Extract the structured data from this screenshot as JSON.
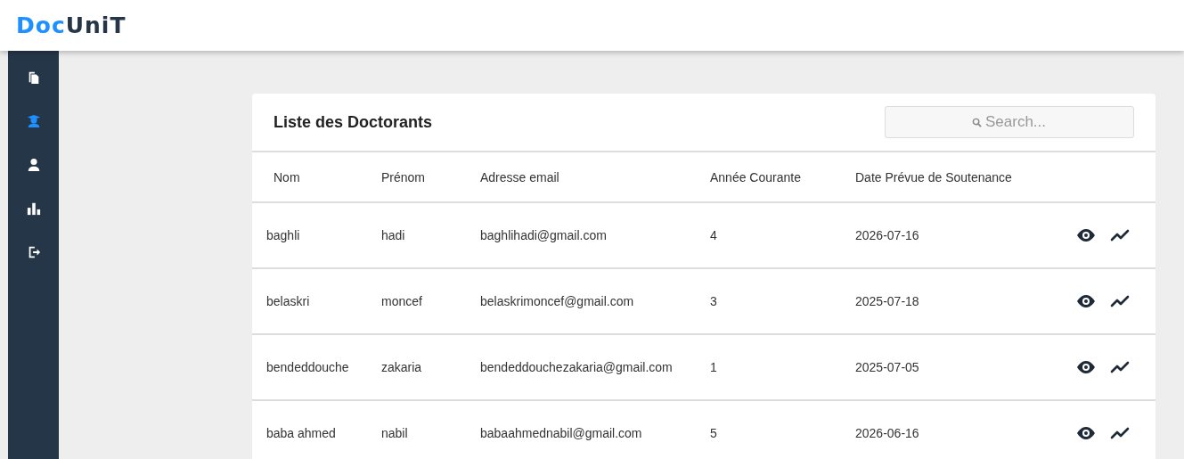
{
  "logo": {
    "accent": "Doc",
    "rest": "UniT"
  },
  "sidebar": {
    "items": [
      {
        "kind": "documents",
        "selected": false
      },
      {
        "kind": "graduate",
        "selected": true
      },
      {
        "kind": "user",
        "selected": false
      },
      {
        "kind": "chart",
        "selected": false
      },
      {
        "kind": "logout",
        "selected": false
      }
    ]
  },
  "card": {
    "title": "Liste des Doctorants",
    "search": {
      "placeholder": "Search..."
    }
  },
  "table": {
    "columns": [
      "Nom",
      "Prénom",
      "Adresse email",
      "Année Courante",
      "Date Prévue de Soutenance"
    ],
    "rows": [
      {
        "cells": [
          "baghli",
          "hadi",
          "baghlihadi@gmail.com",
          "4",
          "2026-07-16"
        ]
      },
      {
        "cells": [
          "belaskri",
          "moncef",
          "belaskrimoncef@gmail.com",
          "3",
          "2025-07-18"
        ]
      },
      {
        "cells": [
          "bendeddouche",
          "zakaria",
          "bendeddouchezakaria@gmail.com",
          "1",
          "2025-07-05"
        ]
      },
      {
        "cells": [
          "baba ahmed",
          "nabil",
          "babaahmednabil@gmail.com",
          "5",
          "2026-06-16"
        ]
      }
    ]
  }
}
